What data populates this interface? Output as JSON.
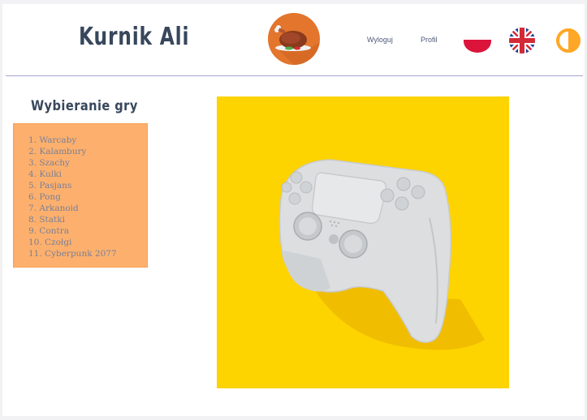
{
  "header": {
    "title": "Kurnik Ali",
    "logo_icon": "roast-chicken-icon",
    "nav": {
      "logout_label": "Wyloguj",
      "profile_label": "Profil"
    },
    "language_icons": [
      "poland-flag-icon",
      "uk-flag-icon"
    ],
    "contrast_icon": "contrast-toggle-icon"
  },
  "sidebar": {
    "heading": "Wybieranie gry",
    "games": [
      "1. Warcaby",
      "2. Kalambury",
      "3. Szachy",
      "4. Kulki",
      "5. Pasjans",
      "6. Pong",
      "7. Arkanoid",
      "8. Statki",
      "9. Contra",
      "10. Czołgi",
      "11. Cyberpunk 2077"
    ]
  },
  "main": {
    "hero_image_icon": "game-controller-image"
  },
  "colors": {
    "title": "#37475c",
    "accent_orange": "#fdb06d",
    "hero_background": "#fdd300",
    "contrast_icon": "#ffa726",
    "divider": "#a6a6d0"
  }
}
